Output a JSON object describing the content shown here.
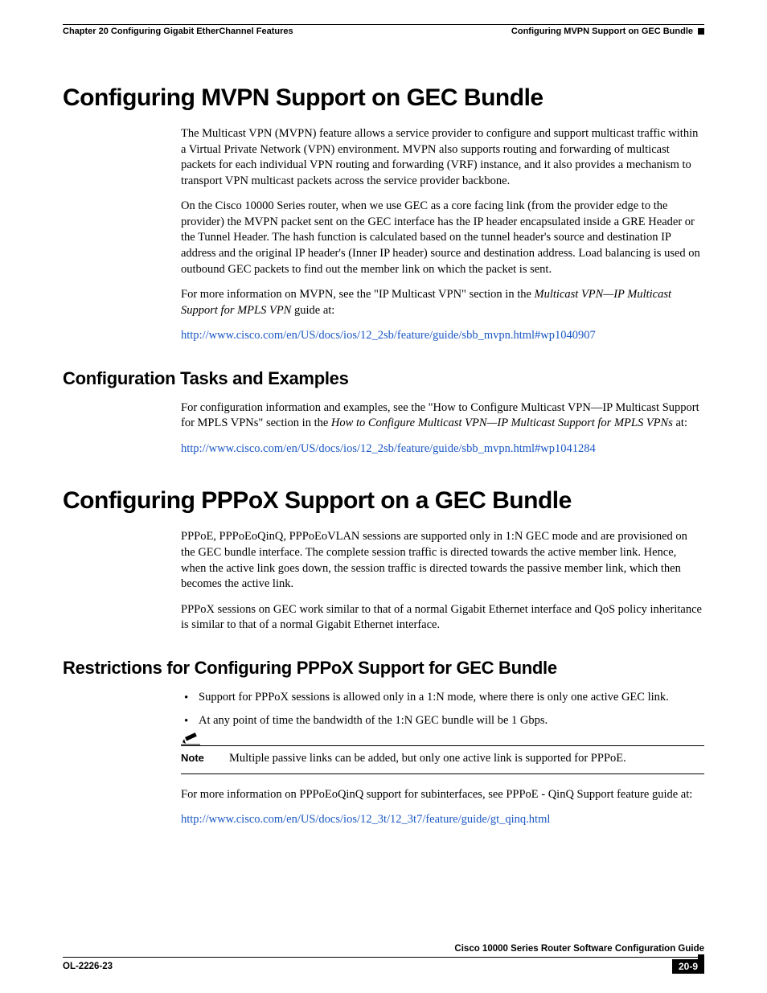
{
  "header": {
    "chapter_line": "Chapter 20    Configuring Gigabit EtherChannel Features",
    "section_line": "Configuring MVPN Support on GEC Bundle"
  },
  "section1": {
    "heading": "Configuring MVPN Support on GEC Bundle",
    "p1": "The Multicast VPN (MVPN) feature allows a service provider to configure and support multicast traffic within a Virtual Private Network (VPN) environment. MVPN also supports routing and forwarding of multicast packets for each individual VPN routing and forwarding (VRF) instance, and it also provides a mechanism to transport VPN multicast packets across the service provider backbone.",
    "p2": "On the Cisco 10000 Series router, when we use GEC as a core facing link (from the provider edge to the provider) the MVPN packet sent on the GEC interface has the IP header encapsulated inside a GRE Header or the Tunnel Header. The hash function is calculated based on the tunnel header's source and destination IP address and the original IP header's (Inner IP header) source and destination address. Load balancing is used on outbound GEC packets to find out the member link on which the packet is sent.",
    "p3_a": "For more information on MVPN, see the \"IP Multicast VPN\" section in the ",
    "p3_i": "Multicast VPN—IP Multicast Support for MPLS VPN",
    "p3_b": " guide at:",
    "link1": "http://www.cisco.com/en/US/docs/ios/12_2sb/feature/guide/sbb_mvpn.html#wp1040907"
  },
  "section1sub": {
    "heading": "Configuration Tasks and Examples",
    "p1_a": "For configuration information and examples, see the \"How to Configure Multicast VPN—IP Multicast Support for MPLS VPNs\" section in the ",
    "p1_i": "How to Configure Multicast VPN—IP Multicast Support for MPLS VPNs",
    "p1_b": " at:",
    "link1": "http://www.cisco.com/en/US/docs/ios/12_2sb/feature/guide/sbb_mvpn.html#wp1041284"
  },
  "section2": {
    "heading": "Configuring PPPoX Support on a GEC Bundle",
    "p1": "PPPoE, PPPoEoQinQ, PPPoEoVLAN sessions are supported only in 1:N GEC mode and are provisioned on the GEC bundle interface. The complete session traffic is directed towards the active member link. Hence, when the active link goes down, the session traffic is directed towards the passive member link, which then becomes the active link.",
    "p2": "PPPoX sessions on GEC work similar to that of a normal Gigabit Ethernet interface and QoS policy inheritance is similar to that of a normal Gigabit Ethernet interface."
  },
  "section2sub": {
    "heading": "Restrictions for Configuring PPPoX Support for GEC Bundle",
    "bullet1": "Support for PPPoX sessions is allowed only in a 1:N mode, where there is only one active GEC link.",
    "bullet2": "At any point of time the bandwidth of the 1:N GEC bundle will be 1 Gbps.",
    "note_label": "Note",
    "note_text": "Multiple passive links can be added, but only one active link is supported for PPPoE.",
    "p1": "For more information on PPPoEoQinQ support for subinterfaces, see PPPoE - QinQ Support feature guide at:",
    "link1": "http://www.cisco.com/en/US/docs/ios/12_3t/12_3t7/feature/guide/gt_qinq.html"
  },
  "footer": {
    "guide_title": "Cisco 10000 Series Router Software Configuration Guide",
    "doc_id": "OL-2226-23",
    "page_num": "20-9"
  }
}
